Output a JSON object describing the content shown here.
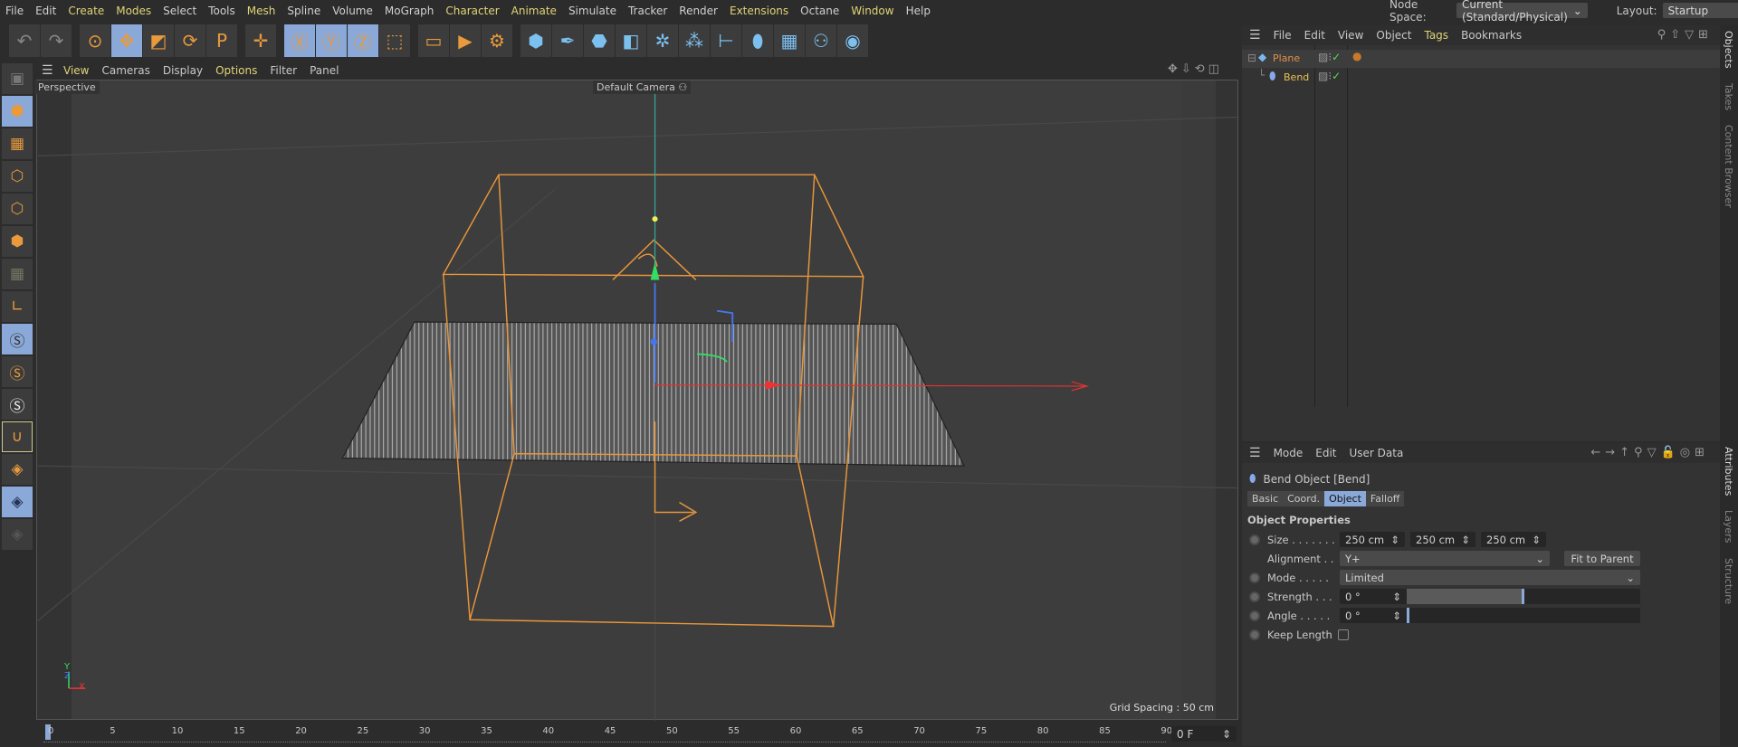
{
  "menu": [
    "File",
    "Edit",
    "Create",
    "Modes",
    "Select",
    "Tools",
    "Mesh",
    "Spline",
    "Volume",
    "MoGraph",
    "Character",
    "Animate",
    "Simulate",
    "Tracker",
    "Render",
    "Extensions",
    "Octane",
    "Window",
    "Help"
  ],
  "menu_highlight": [
    "Create",
    "Modes",
    "Mesh",
    "Character",
    "Animate",
    "Extensions",
    "Window"
  ],
  "node_space": {
    "label": "Node Space:",
    "value": "Current (Standard/Physical)"
  },
  "layout": {
    "label": "Layout:",
    "value": "Startup"
  },
  "toolbar": [
    "undo-icon",
    "redo-icon",
    "select-icon",
    "move-icon",
    "scale-icon",
    "rotate-icon",
    "psr-icon",
    "world-axis-icon",
    "x-axis-icon",
    "y-axis-icon",
    "z-axis-icon",
    "coordinate-system-icon",
    "render-view-icon",
    "render-icon",
    "render-settings-icon",
    "cube-icon",
    "pen-icon",
    "subdivision-icon",
    "extrude-icon",
    "cloner-icon",
    "array-icon",
    "bend-icon",
    "deformer-icon",
    "floor-icon",
    "camera-icon",
    "light-icon"
  ],
  "viewport": {
    "menu": [
      "View",
      "Cameras",
      "Display",
      "Options",
      "Filter",
      "Panel"
    ],
    "name": "Perspective",
    "camera": "Default Camera",
    "grid_spacing": "Grid Spacing : 50 cm",
    "axis": {
      "x": "X",
      "y": "Y",
      "z": "Z"
    }
  },
  "timeline": {
    "ticks": [
      "0",
      "5",
      "10",
      "15",
      "20",
      "25",
      "30",
      "35",
      "40",
      "45",
      "50",
      "55",
      "60",
      "65",
      "70",
      "75",
      "80",
      "85",
      "90"
    ],
    "frame": "0 F"
  },
  "objects": {
    "menu": [
      "File",
      "Edit",
      "View",
      "Object",
      "Tags",
      "Bookmarks"
    ],
    "items": [
      {
        "name": "Plane",
        "color": "#e0904a"
      },
      {
        "name": "Bend",
        "color": "#e8c050"
      }
    ]
  },
  "side_tabs_top": [
    "Objects",
    "Takes",
    "Content Browser"
  ],
  "side_tabs_bottom": [
    "Attributes",
    "Layers",
    "Structure"
  ],
  "attributes": {
    "menu": [
      "Mode",
      "Edit",
      "User Data"
    ],
    "title": "Bend Object [Bend]",
    "tabs": [
      "Basic",
      "Coord.",
      "Object",
      "Falloff"
    ],
    "active_tab": "Object",
    "section": "Object Properties",
    "size_label": "Size . . . . . . .",
    "size": [
      "250 cm",
      "250 cm",
      "250 cm"
    ],
    "alignment_label": "Alignment . .",
    "alignment": "Y+",
    "fit_button": "Fit to Parent",
    "mode_label": "Mode . . . . .",
    "mode": "Limited",
    "strength_label": "Strength . . .",
    "strength": "0 °",
    "angle_label": "Angle . . . . .",
    "angle": "0 °",
    "keep_length_label": "Keep Length",
    "keep_length": false
  },
  "colors": {
    "accent": "#e89a3c",
    "selection": "#8aa8d8",
    "x_axis": "#e04040",
    "y_axis": "#40d070",
    "z_axis": "#4080e0"
  }
}
